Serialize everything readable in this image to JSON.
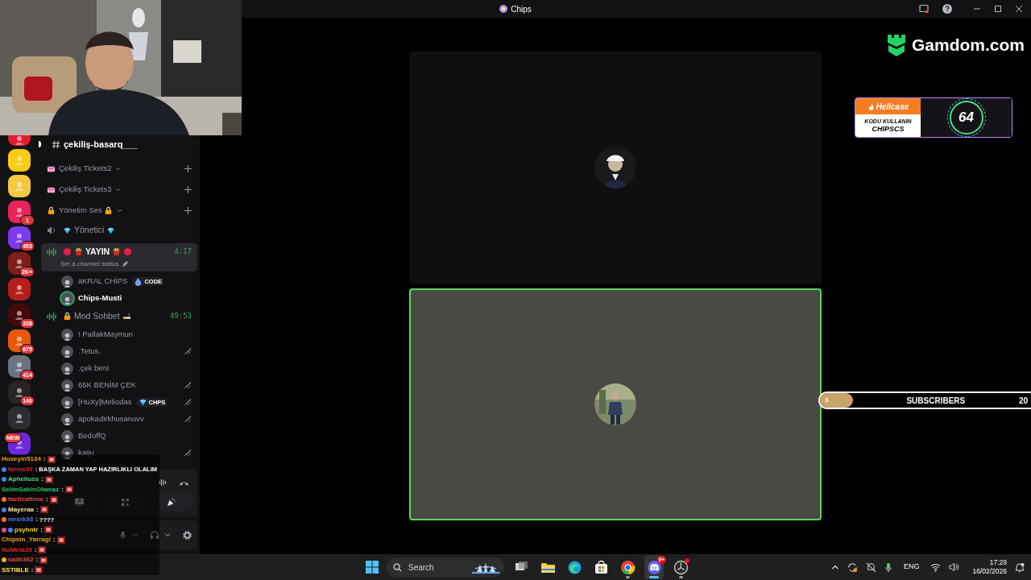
{
  "window": {
    "title": "Chips"
  },
  "servers": [
    {
      "color": "#e11d2e"
    },
    {
      "color": "#facc15"
    },
    {
      "color": "#f5c842"
    },
    {
      "color": "#e8245a",
      "badge": "1"
    },
    {
      "color": "#7c3aed",
      "badge": "453"
    },
    {
      "color": "#7f1d1d",
      "badge": "2K+"
    },
    {
      "color": "#b91c1c"
    },
    {
      "color": "#450a0a",
      "badge": "338"
    },
    {
      "color": "#ea580c",
      "badge": "675"
    },
    {
      "color": "#6b7280",
      "badge": "414"
    },
    {
      "color": "#292524",
      "badge": "140"
    },
    {
      "color": "#2b2d31"
    },
    {
      "color": "#6d28d9",
      "badge": "NEW"
    }
  ],
  "channels": [
    {
      "kind": "text",
      "name": "çekiliş-basarq___",
      "unread": true
    },
    {
      "kind": "category",
      "name": "Çekiliş Tickets2"
    },
    {
      "kind": "category",
      "name": "Çekiliş Tickets3"
    },
    {
      "kind": "category",
      "name": "Yönetim Ses"
    },
    {
      "kind": "voice",
      "name": "Yönetici",
      "live": false,
      "selected": false
    },
    {
      "kind": "voice",
      "name": "YAYIN",
      "live": true,
      "selected": true,
      "time": "4:17",
      "status": "Set a channel status",
      "members": [
        {
          "name": "aKRAL CHİPS",
          "speaking": false,
          "muted": false,
          "tag": {
            "label": "CODE"
          }
        },
        {
          "name": "Chips-Musti",
          "speaking": true,
          "muted": false
        }
      ]
    },
    {
      "kind": "voice",
      "name": "Mod Sohbet",
      "live": true,
      "selected": false,
      "time": "49:53",
      "members": [
        {
          "name": "! PatlakMaymun",
          "speaking": false,
          "muted": false
        },
        {
          "name": ".Tetus.",
          "speaking": false,
          "muted": true
        },
        {
          "name": ".çek beni",
          "speaking": false,
          "muted": false
        },
        {
          "name": "65K BENİM ÇEK",
          "speaking": false,
          "muted": true
        },
        {
          "name": "[HuXy]Meliodas",
          "speaking": false,
          "muted": true,
          "tag": {
            "label": "CHPS"
          }
        },
        {
          "name": "apokadirkhusanovv",
          "speaking": false,
          "muted": true
        },
        {
          "name": "BedoffQ",
          "speaking": false,
          "muted": false
        },
        {
          "name": "kaiju",
          "speaking": false,
          "muted": true
        }
      ]
    }
  ],
  "chat": [
    {
      "user": "Huseyin5134",
      "separator": ":",
      "color": "#f59e0b",
      "emote": true
    },
    {
      "user": "farms90",
      "separator": ":",
      "color": "#dc2626",
      "badges": [
        {
          "color": "#3b82f6"
        }
      ],
      "text": "BAŞKA ZAMAN YAP HAZIRLIKLI OLALIM",
      "emote": false
    },
    {
      "user": "Apheliuss",
      "separator": ":",
      "color": "#4ade80",
      "badges": [
        {
          "color": "#3b82f6"
        }
      ],
      "emote": true
    },
    {
      "user": "SelimSakinOlamaz",
      "separator": ":",
      "color": "#22c55e",
      "emote": true
    },
    {
      "user": "tacticaltime",
      "separator": ":",
      "color": "#ef4444",
      "badges": [
        {
          "color": "#f97316"
        }
      ],
      "emote": true
    },
    {
      "user": "Mayeraa",
      "separator": ":",
      "color": "#fde68a",
      "badges": [
        {
          "color": "#3b82f6"
        }
      ],
      "emote": true
    },
    {
      "user": "mrsrk93",
      "separator": ":",
      "color": "#4f7bf0",
      "badges": [
        {
          "color": "#f97316"
        }
      ],
      "text": "????",
      "emote": false
    },
    {
      "user": "psyhntr",
      "separator": ":",
      "color": "#facc15",
      "badges": [
        {
          "color": "#ec4899"
        },
        {
          "color": "#3b82f6"
        }
      ],
      "emote": true
    },
    {
      "user": "Chipsin_Yarragi",
      "separator": ":",
      "color": "#f59e0b",
      "emote": true
    },
    {
      "user": "NoMeta33",
      "separator": ":",
      "color": "#dc2626",
      "emote": true
    },
    {
      "user": "salih362",
      "separator": ":",
      "color": "#ef4444",
      "badges": [
        {
          "color": "#eab308"
        }
      ],
      "emote": true
    },
    {
      "user": "SSTIBLE",
      "separator": ":",
      "color": "#fde047",
      "emote": true
    }
  ],
  "logo": {
    "text": "Gamdom.com"
  },
  "promo": {
    "brand": "Hellcase",
    "caption": "KODU KULLANIN",
    "code": "CHIPSCS",
    "count": "64"
  },
  "subscribers": {
    "current": "3",
    "label": "SUBSCRIBERS",
    "goal": "20",
    "level": 0.15
  },
  "taskbar": {
    "search": {
      "placeholder": "Search"
    },
    "apps": [
      {
        "kind": "taskview",
        "running": false,
        "selected": false
      },
      {
        "kind": "folder",
        "running": false,
        "selected": false
      },
      {
        "kind": "edge",
        "running": false,
        "selected": false
      },
      {
        "kind": "store",
        "running": false,
        "selected": false
      },
      {
        "kind": "chrome",
        "running": true,
        "selected": false
      },
      {
        "kind": "discord",
        "running": true,
        "selected": true,
        "badge": "9+"
      },
      {
        "kind": "recorder",
        "running": true,
        "selected": false
      }
    ],
    "language": "ENG",
    "time": "17:29",
    "date": "16/02/2026"
  }
}
